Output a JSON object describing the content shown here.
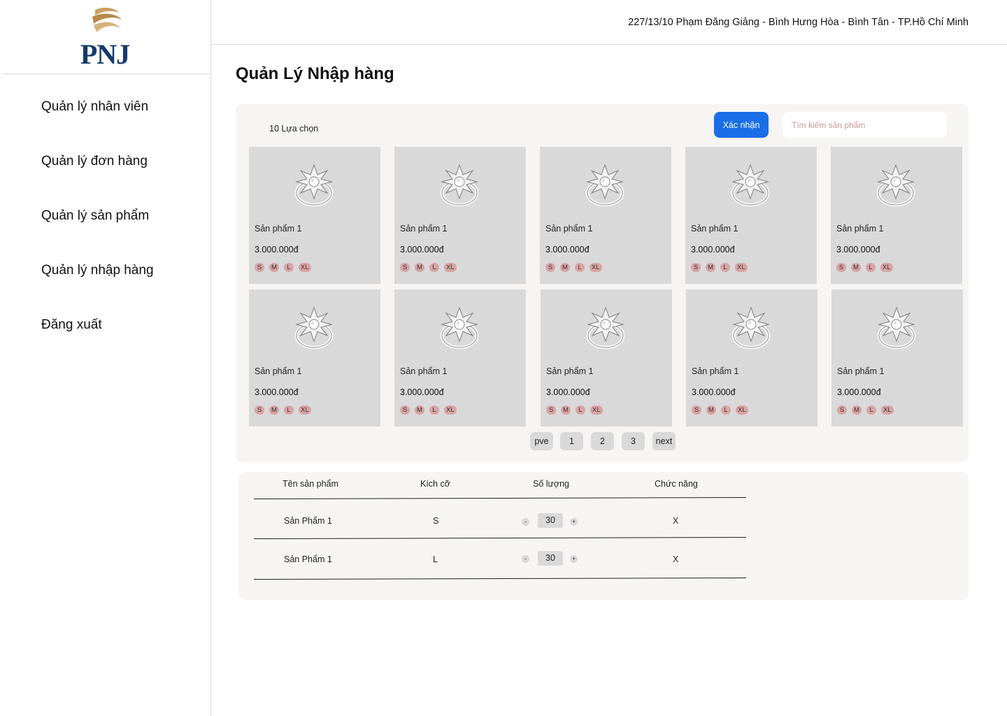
{
  "brand": {
    "logo_text": "PNJ"
  },
  "sidebar": {
    "items": [
      {
        "label": "Quản lý nhân viên"
      },
      {
        "label": "Quản lý đơn hàng"
      },
      {
        "label": "Quản lý sản phẩm"
      },
      {
        "label": "Quản lý nhập hàng"
      },
      {
        "label": "Đăng xuất"
      }
    ]
  },
  "header": {
    "address": "227/13/10 Phạm Đăng Giảng - Bình Hưng Hòa - Bình Tân - TP.Hồ Chí Minh"
  },
  "page": {
    "title": "Quản Lý Nhập hàng"
  },
  "toolbar": {
    "selection_count": "10 Lựa chọn",
    "confirm_label": "Xác nhận",
    "search_placeholder": "Tìm kiếm sản phẩm",
    "search_value": ""
  },
  "products": [
    {
      "name": "Sản phẩm 1",
      "price": "3.000.000đ",
      "sizes": [
        "S",
        "M",
        "L",
        "XL"
      ]
    },
    {
      "name": "Sản phẩm 1",
      "price": "3.000.000đ",
      "sizes": [
        "S",
        "M",
        "L",
        "XL"
      ]
    },
    {
      "name": "Sản phẩm 1",
      "price": "3.000.000đ",
      "sizes": [
        "S",
        "M",
        "L",
        "XL"
      ]
    },
    {
      "name": "Sản phẩm 1",
      "price": "3.000.000đ",
      "sizes": [
        "S",
        "M",
        "L",
        "XL"
      ]
    },
    {
      "name": "Sản phẩm 1",
      "price": "3.000.000đ",
      "sizes": [
        "S",
        "M",
        "L",
        "XL"
      ]
    },
    {
      "name": "Sản phẩm 1",
      "price": "3.000.000đ",
      "sizes": [
        "S",
        "M",
        "L",
        "XL"
      ]
    },
    {
      "name": "Sản phẩm 1",
      "price": "3.000.000đ",
      "sizes": [
        "S",
        "M",
        "L",
        "XL"
      ]
    },
    {
      "name": "Sản phẩm 1",
      "price": "3.000.000đ",
      "sizes": [
        "S",
        "M",
        "L",
        "XL"
      ]
    },
    {
      "name": "Sản phẩm 1",
      "price": "3.000.000đ",
      "sizes": [
        "S",
        "M",
        "L",
        "XL"
      ]
    },
    {
      "name": "Sản phẩm 1",
      "price": "3.000.000đ",
      "sizes": [
        "S",
        "M",
        "L",
        "XL"
      ]
    }
  ],
  "pagination": {
    "prev_label": "pve",
    "pages": [
      "1",
      "2",
      "3"
    ],
    "next_label": "next"
  },
  "order_table": {
    "headers": {
      "name": "Tên sản phẩm",
      "size": "Kích cỡ",
      "quantity": "Số lượng",
      "action": "Chức năng"
    },
    "rows": [
      {
        "name": "Sản Phẩm 1",
        "size": "S",
        "quantity": "30",
        "minus": "-",
        "plus": "+",
        "remove": "X"
      },
      {
        "name": "Sản Phẩm 1",
        "size": "L",
        "quantity": "30",
        "minus": "-",
        "plus": "+",
        "remove": "X"
      }
    ]
  },
  "colors": {
    "accent": "#1a6ee8",
    "panel": "#f6f5f3",
    "card": "#d9d9d9",
    "size_chip": "#d9a3a3",
    "logo_blue": "#143a6b",
    "logo_gold": "#c9a063"
  },
  "icons": {
    "logo": "pnj-swirl-icon",
    "product": "diamond-ring-icon"
  }
}
